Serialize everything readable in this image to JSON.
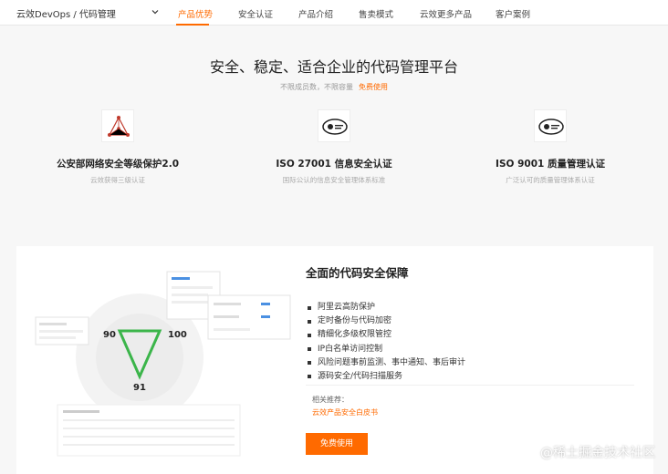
{
  "nav": {
    "brand": "云效DevOps / 代码管理",
    "tabs": [
      "产品优势",
      "安全认证",
      "产品介绍",
      "售卖模式",
      "云效更多产品",
      "客户案例"
    ],
    "active_tab": 0
  },
  "hero": {
    "title": "安全、稳定、适合企业的代码管理平台",
    "subtitle": "不限成员数，不限容量",
    "cta_link": "免费使用"
  },
  "certs": [
    {
      "icon": "network-triangle-icon",
      "title": "公安部网络安全等级保护2.0",
      "desc": "云效获得三级认证"
    },
    {
      "icon": "iso-badge-icon",
      "title": "ISO 27001 信息安全认证",
      "desc": "国际公认的信息安全管理体系标准"
    },
    {
      "icon": "iso-badge-icon",
      "title": "ISO 9001 质量管理认证",
      "desc": "广泛认可的质量管理体系认证"
    }
  ],
  "card": {
    "title": "全面的代码安全保障",
    "features": [
      "阿里云高防保护",
      "定时备份与代码加密",
      "精细化多级权限管控",
      "IP白名单访问控制",
      "风险问题事前监测、事中通知、事后审计",
      "源码安全/代码扫描服务"
    ],
    "related_label": "相关推荐：",
    "related_link": "云效产品安全白皮书",
    "cta": "免费使用",
    "illus": {
      "score_left": "90",
      "score_right": "100",
      "score_bottom": "91"
    }
  },
  "watermark": "@稀土掘金技术社区",
  "colors": {
    "accent": "#ff6a00"
  }
}
